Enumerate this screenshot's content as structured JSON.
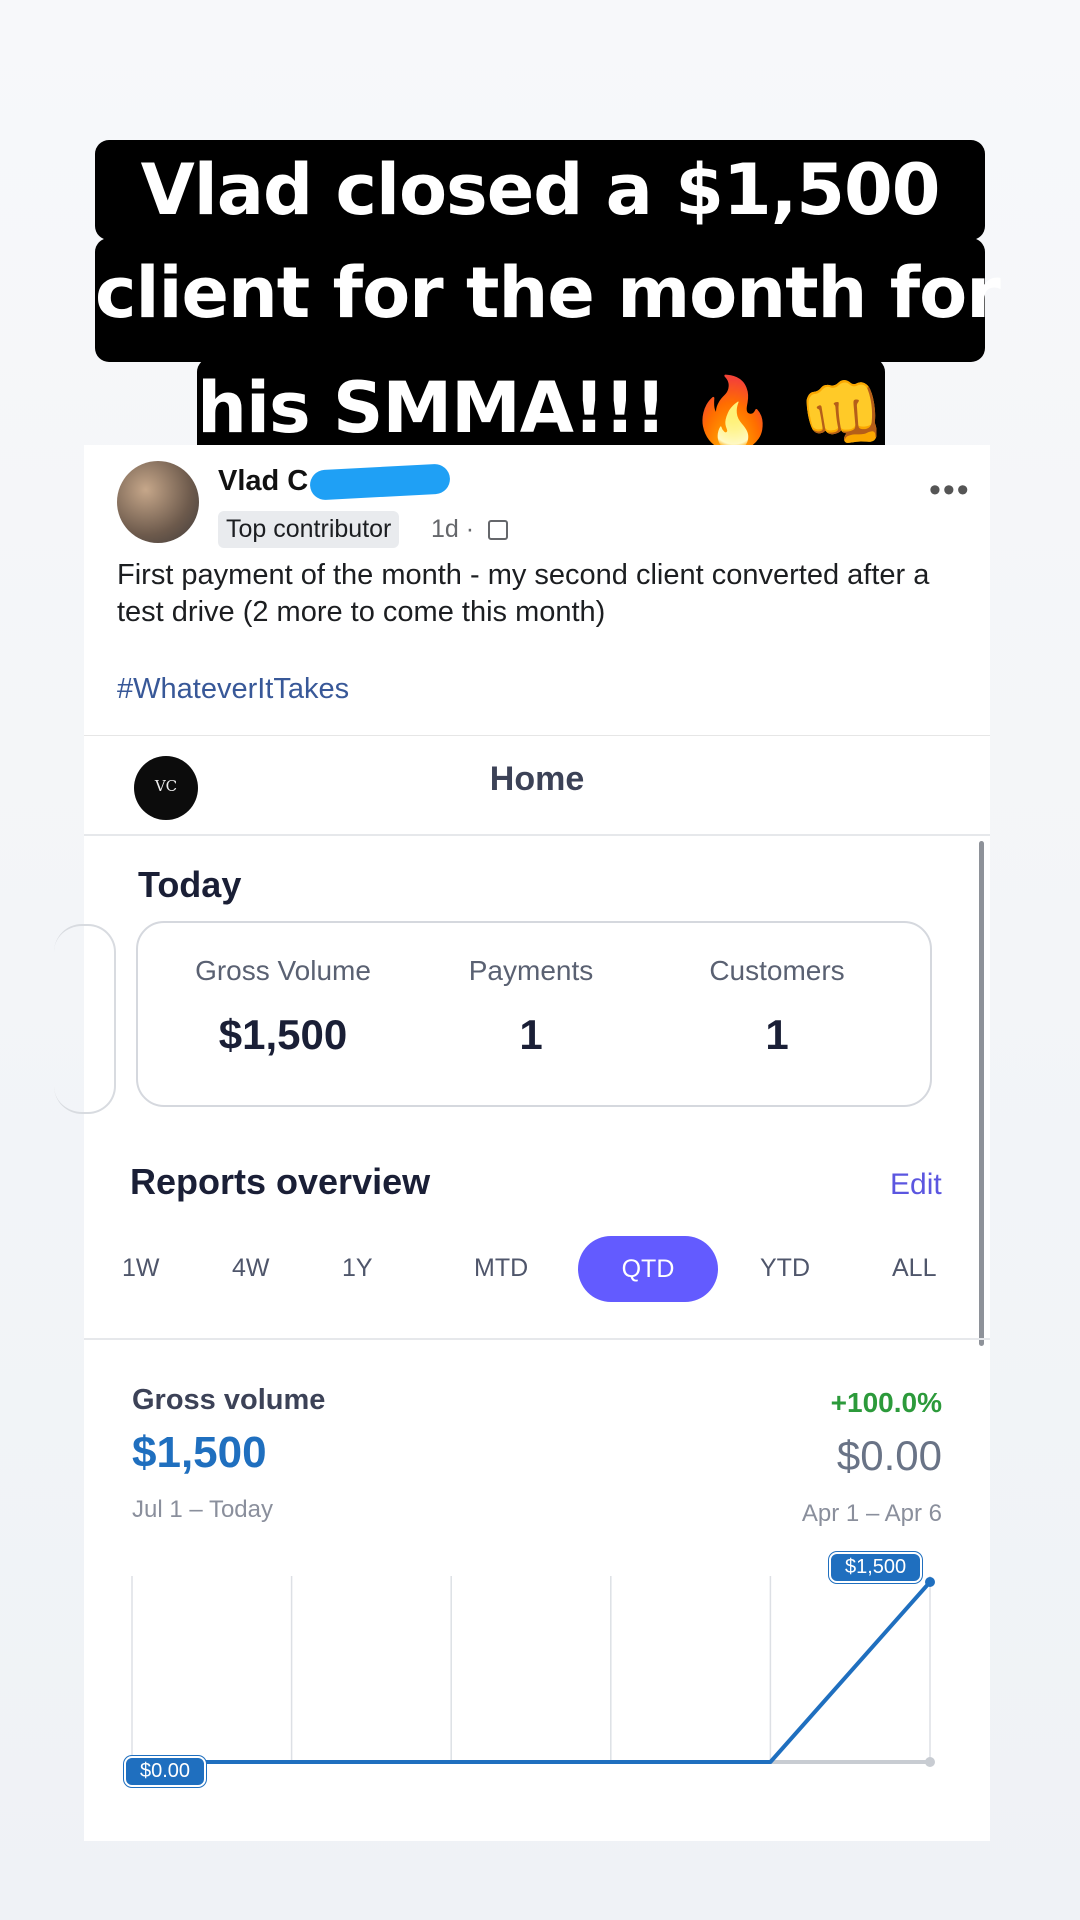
{
  "caption": {
    "line1": "Vlad closed a $1,500",
    "line2": "client for the month for",
    "line3": "his SMMA!!!",
    "emoji": [
      "🔥",
      "👊"
    ]
  },
  "post": {
    "author": "Vlad C",
    "badge": "Top contributor",
    "time": "1d ·",
    "more_icon": "•••",
    "text": "First payment of the month - my second client converted after a test drive (2 more to come this month)",
    "hashtag": "#WhateverItTakes"
  },
  "app": {
    "logo_text": "VC",
    "header_title": "Home",
    "today": {
      "title": "Today",
      "stats": [
        {
          "label": "Gross Volume",
          "value": "$1,500"
        },
        {
          "label": "Payments",
          "value": "1"
        },
        {
          "label": "Customers",
          "value": "1"
        }
      ]
    },
    "reports": {
      "title": "Reports overview",
      "edit_label": "Edit",
      "ranges": [
        "1W",
        "4W",
        "1Y",
        "MTD",
        "QTD",
        "YTD",
        "ALL"
      ],
      "active_range": "QTD"
    },
    "gross_volume": {
      "label": "Gross volume",
      "value": "$1,500",
      "period": "Jul 1 – Today",
      "change": "+100.0%",
      "prev_value": "$0.00",
      "prev_period": "Apr 1 – Apr 6"
    }
  },
  "chart_data": {
    "type": "line",
    "x": [
      0,
      1,
      2,
      3,
      4,
      5
    ],
    "series": [
      {
        "values": [
          0,
          0,
          0,
          0,
          0,
          1500
        ],
        "color": "#1f6fbf"
      },
      {
        "values": [
          0,
          0,
          0,
          0,
          0,
          0
        ],
        "color": "#c8ccd2"
      }
    ],
    "point_labels": {
      "start": "$0.00",
      "end": "$1,500"
    },
    "ylim": [
      0,
      1500
    ],
    "grid": true,
    "colors": {
      "accent": "#635bff",
      "line": "#1f6fbf",
      "positive": "#2c9a3b"
    }
  }
}
